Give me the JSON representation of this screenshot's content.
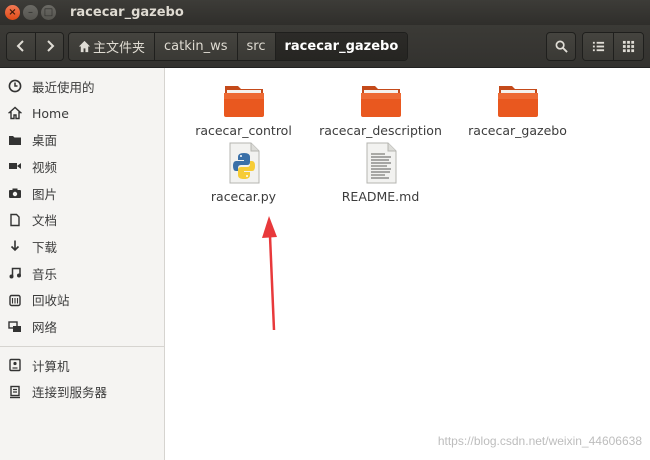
{
  "window": {
    "title": "racecar_gazebo",
    "close_glyph": "×",
    "minimize_glyph": "–",
    "maximize_glyph": "□"
  },
  "toolbar": {
    "back_icon": "chevron-left-icon",
    "forward_icon": "chevron-right-icon",
    "breadcrumbs": [
      {
        "label": "主文件夹",
        "icon": "home-icon"
      },
      {
        "label": "catkin_ws"
      },
      {
        "label": "src"
      },
      {
        "label": "racecar_gazebo",
        "active": true
      }
    ],
    "search_icon": "search-icon",
    "list_view_icon": "list-view-icon",
    "grid_view_icon": "grid-view-icon"
  },
  "sidebar": {
    "items": [
      {
        "label": "最近使用的",
        "icon": "clock-icon"
      },
      {
        "label": "Home",
        "icon": "home-icon"
      },
      {
        "label": "桌面",
        "icon": "folder-icon"
      },
      {
        "label": "视频",
        "icon": "video-icon"
      },
      {
        "label": "图片",
        "icon": "camera-icon"
      },
      {
        "label": "文档",
        "icon": "document-icon"
      },
      {
        "label": "下载",
        "icon": "download-icon"
      },
      {
        "label": "音乐",
        "icon": "music-icon"
      },
      {
        "label": "回收站",
        "icon": "trash-icon"
      },
      {
        "label": "网络",
        "icon": "network-icon"
      },
      {
        "label": "计算机",
        "icon": "computer-icon"
      },
      {
        "label": "连接到服务器",
        "icon": "server-icon"
      }
    ]
  },
  "files": [
    {
      "name": "racecar_control",
      "type": "folder"
    },
    {
      "name": "racecar_description",
      "type": "folder"
    },
    {
      "name": "racecar_gazebo",
      "type": "folder"
    },
    {
      "name": "racecar.py",
      "type": "python"
    },
    {
      "name": "README.md",
      "type": "text"
    }
  ],
  "watermark": "https://blog.csdn.net/weixin_44606638",
  "colors": {
    "folder_orange": "#e9581f",
    "arrow_red": "#e8393b",
    "close_button": "#e95420"
  }
}
